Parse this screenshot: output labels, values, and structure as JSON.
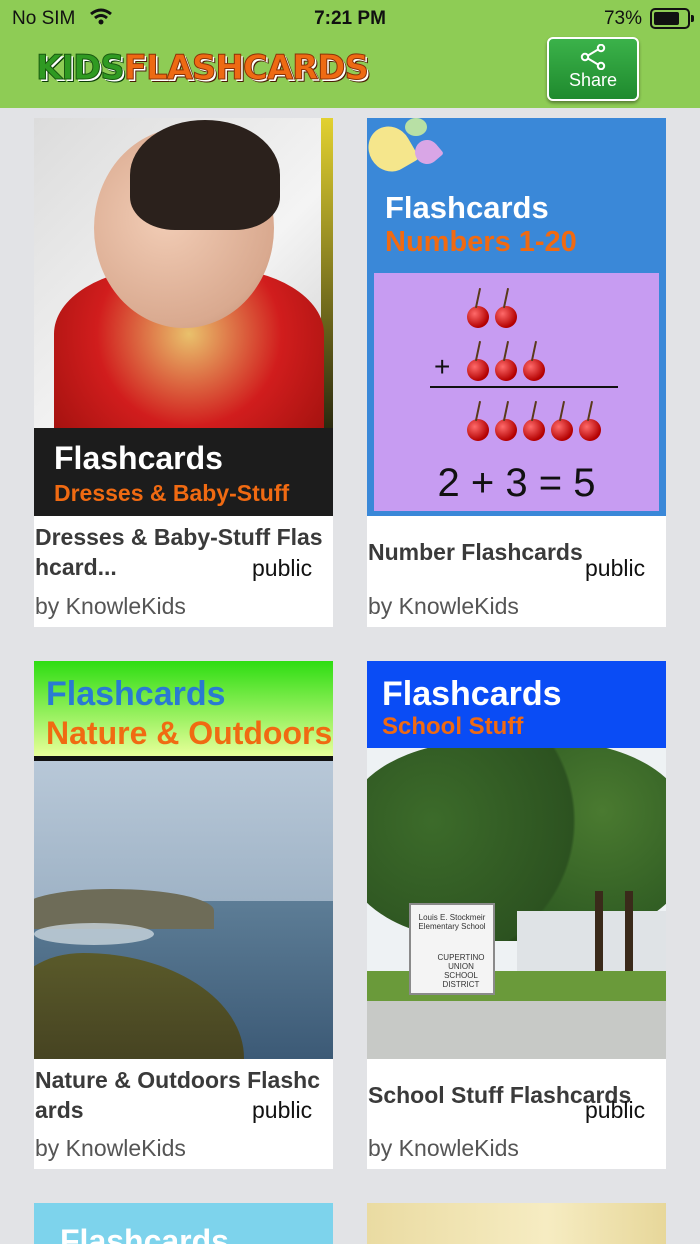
{
  "status_bar": {
    "carrier": "No SIM",
    "time": "7:21 PM",
    "battery": "73%"
  },
  "header": {
    "logo_part1": "Kids",
    "logo_part2": "Flashcards",
    "share_label": "Share"
  },
  "decks": [
    {
      "cover_heading": "Flashcards",
      "cover_subheading": "Dresses & Baby-Stuff",
      "title": "Dresses & Baby-Stuff Flashcard...",
      "visibility": "public",
      "author": "by KnowleKids"
    },
    {
      "cover_heading": "Flashcards",
      "cover_subheading": "Numbers 1-20",
      "cover_equation": "2 + 3 = 5",
      "cover_plus": "+",
      "title": "Number Flashcards",
      "visibility": "public",
      "author": "by KnowleKids"
    },
    {
      "cover_heading": "Flashcards",
      "cover_subheading": "Nature & Outdoors",
      "title": "Nature & Outdoors Flashcards",
      "visibility": "public",
      "author": "by KnowleKids"
    },
    {
      "cover_heading": "Flashcards",
      "cover_subheading": "School Stuff",
      "cover_sign_text": "Louis E. Stockmeir Elementary School",
      "cover_sign_district": "CUPERTINO UNION SCHOOL DISTRICT",
      "title": "School Stuff Flashcards",
      "visibility": "public",
      "author": "by KnowleKids"
    },
    {
      "cover_heading": "Flashcards"
    }
  ]
}
